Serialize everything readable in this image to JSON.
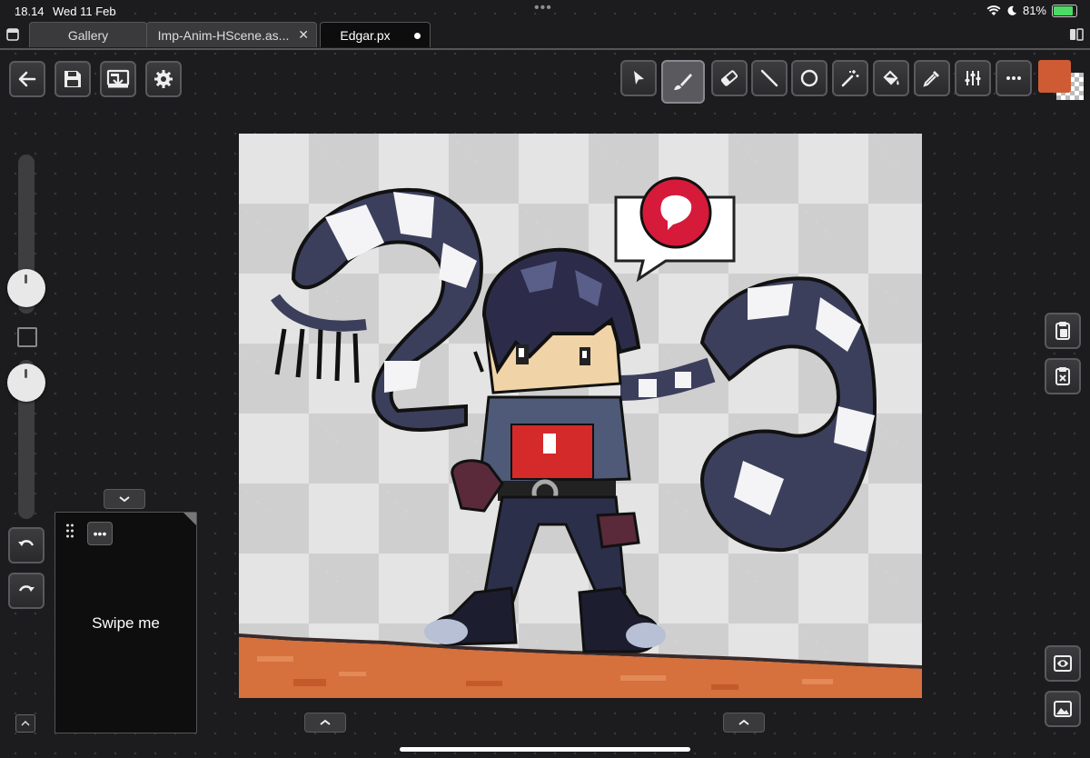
{
  "status": {
    "time": "18.14",
    "date": "Wed 11 Feb",
    "battery": "81%",
    "battery_level": 0.81,
    "multitask_dots": "•••"
  },
  "tabs": [
    {
      "label": "Gallery",
      "active": false
    },
    {
      "label": "Imp-Anim-HScene.as...",
      "active": false,
      "close_glyph": "✕"
    },
    {
      "label": "Edgar.px",
      "active": true
    }
  ],
  "toolbar_left": [
    "back-icon",
    "save-icon",
    "export-icon",
    "gear-icon"
  ],
  "toolbar_right": [
    "select-pointer-icon",
    "brush-icon",
    "eraser-icon",
    "line-icon",
    "circle-icon",
    "magic-wand-icon",
    "fill-bucket-icon",
    "eyedropper-icon",
    "adjust-icon",
    "more-icon"
  ],
  "active_tool": "brush-icon",
  "current_color": "#cf5b34",
  "colors": {
    "background": "#1c1c1e",
    "button": "#2f2f31",
    "ground": "#d6703c",
    "scarf_dark": "#3b3f5c",
    "shirt": "#d42a2a"
  },
  "layer_panel": {
    "more_label": "•••",
    "text": "Swipe me"
  },
  "right_side_buttons": [
    "paste-icon",
    "clear-clipboard-icon",
    "preview-icon",
    "reference-image-icon"
  ],
  "undo_icon": "undo-icon",
  "redo_icon": "redo-icon"
}
